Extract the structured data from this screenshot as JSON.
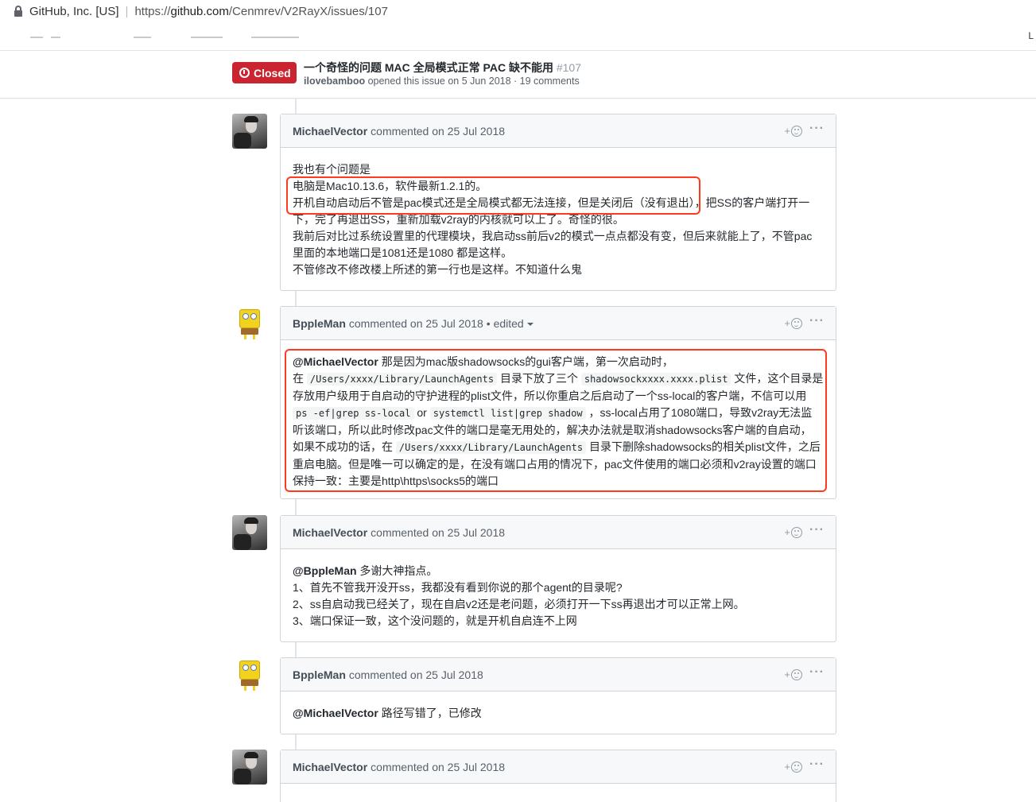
{
  "browser": {
    "org": "GitHub, Inc. [US]",
    "url_prefix": "https://",
    "url_host": "github.com",
    "url_path": "/Cenmrev/V2RayX/issues/107",
    "edge_text": "L"
  },
  "issue": {
    "state": "Closed",
    "title": "一个奇怪的问题 MAC 全局模式正常 PAC 缺不能用",
    "number": "#107",
    "author": "ilovebamboo",
    "meta": " opened this issue on 5 Jun 2018 · 19 comments"
  },
  "comments": [
    {
      "author": "MichaelVector",
      "date": " commented on 25 Jul 2018",
      "lines": [
        "我也有个问题是",
        "电脑是Mac10.13.6，软件最新1.2.1的。",
        "开机自动启动后不管是pac模式还是全局模式都无法连接，但是关闭后（没有退出），把SS的客户端打开一",
        "下，完了再退出SS，重新加载v2ray的内核就可以上了。奇怪的很。",
        "我前后对比过系统设置里的代理模块，我启动ss前后v2的模式一点点都没有变，但后来就能上了，不管pac",
        "里面的本地端口是1081还是1080 都是这样。",
        "不管修改不修改楼上所述的第一行也是这样。不知道什么鬼"
      ]
    },
    {
      "author": "BppleMan",
      "date": " commented on 25 Jul 2018",
      "edited": "• edited",
      "mention": "@MichaelVector",
      "p1": " 那是因为mac版shadowsocks的gui客户端，第一次启动时，",
      "p2a": "在 ",
      "code1": "/Users/xxxx/Library/LaunchAgents",
      "p2b": " 目录下放了三个 ",
      "code2": "shadowsockxxxx.xxxx.plist",
      "p2c": " 文件，这个目录是",
      "p3": "存放用户级用于自启动的守护进程的plist文件，所以你重启之后启动了一个ss-local的客户端，不信可以用",
      "code3": "ps -ef|grep ss-local",
      "p4a": " or ",
      "code4": "systemctl list|grep shadow",
      "p4b": " ，ss-local占用了1080端口，导致v2ray无法监",
      "p5": "听该端口，所以此时修改pac文件的端口是毫无用处的，解决办法就是取消shadowsocks客户端的自启动，",
      "p6a": "如果不成功的话，在 ",
      "code5": "/Users/xxxx/Library/LaunchAgents",
      "p6b": " 目录下删除shadowsocks的相关plist文件，之后",
      "p7": "重启电脑。但是唯一可以确定的是，在没有端口占用的情况下，pac文件使用的端口必须和v2ray设置的端口",
      "p8": "保持一致：主要是http\\https\\socks5的端口"
    },
    {
      "author": "MichaelVector",
      "date": " commented on 25 Jul 2018",
      "mention": "@BppleMan",
      "l1": " 多谢大神指点。",
      "l2": "1、首先不管我开没开ss，我都没有看到你说的那个agent的目录呢?",
      "l3": "2、ss自启动我已经关了，现在自启v2还是老问题，必须打开一下ss再退出才可以正常上网。",
      "l4": "3、端口保证一致，这个没问题的，就是开机自启连不上网"
    },
    {
      "author": "BppleMan",
      "date": " commented on 25 Jul 2018",
      "mention": "@MichaelVector",
      "l1": " 路径写错了，已修改"
    },
    {
      "author": "MichaelVector",
      "date": " commented on 25 Jul 2018"
    }
  ],
  "ui": {
    "react_plus": "+",
    "more": "···"
  },
  "colors": {
    "closed_red": "#cb2431",
    "highlight": "#ff3b1f"
  }
}
